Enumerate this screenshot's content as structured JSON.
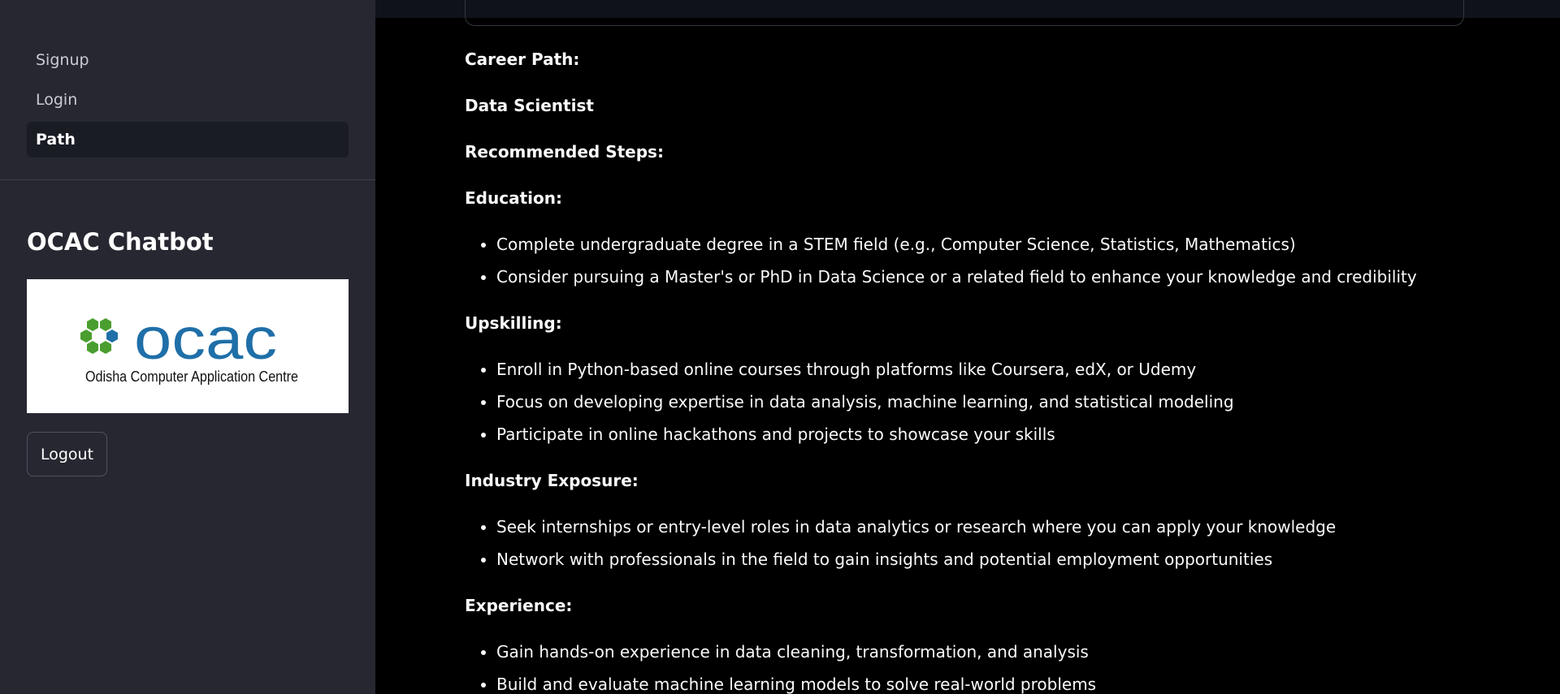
{
  "sidebar": {
    "nav": [
      {
        "label": "Signup",
        "active": false
      },
      {
        "label": "Login",
        "active": false
      },
      {
        "label": "Path",
        "active": true
      }
    ],
    "title": "OCAC Chatbot",
    "logo": {
      "text": "ocac",
      "caption": "Odisha Computer Application Centre",
      "colors": {
        "text": "#1f6fa8",
        "hex_green": "#4a9e2f",
        "hex_blue": "#1f6fa8"
      }
    },
    "logout_label": "Logout"
  },
  "main": {
    "career_path_heading": "Career Path:",
    "career_title": "Data Scientist",
    "recommended_heading": "Recommended Steps:",
    "sections": [
      {
        "heading": "Education:",
        "items": [
          "Complete undergraduate degree in a STEM field (e.g., Computer Science, Statistics, Mathematics)",
          "Consider pursuing a Master's or PhD in Data Science or a related field to enhance your knowledge and credibility"
        ]
      },
      {
        "heading": "Upskilling:",
        "items": [
          "Enroll in Python-based online courses through platforms like Coursera, edX, or Udemy",
          "Focus on developing expertise in data analysis, machine learning, and statistical modeling",
          "Participate in online hackathons and projects to showcase your skills"
        ]
      },
      {
        "heading": "Industry Exposure:",
        "items": [
          "Seek internships or entry-level roles in data analytics or research where you can apply your knowledge",
          "Network with professionals in the field to gain insights and potential employment opportunities"
        ]
      },
      {
        "heading": "Experience:",
        "items": [
          "Gain hands-on experience in data cleaning, transformation, and analysis",
          "Build and evaluate machine learning models to solve real-world problems"
        ]
      }
    ]
  }
}
